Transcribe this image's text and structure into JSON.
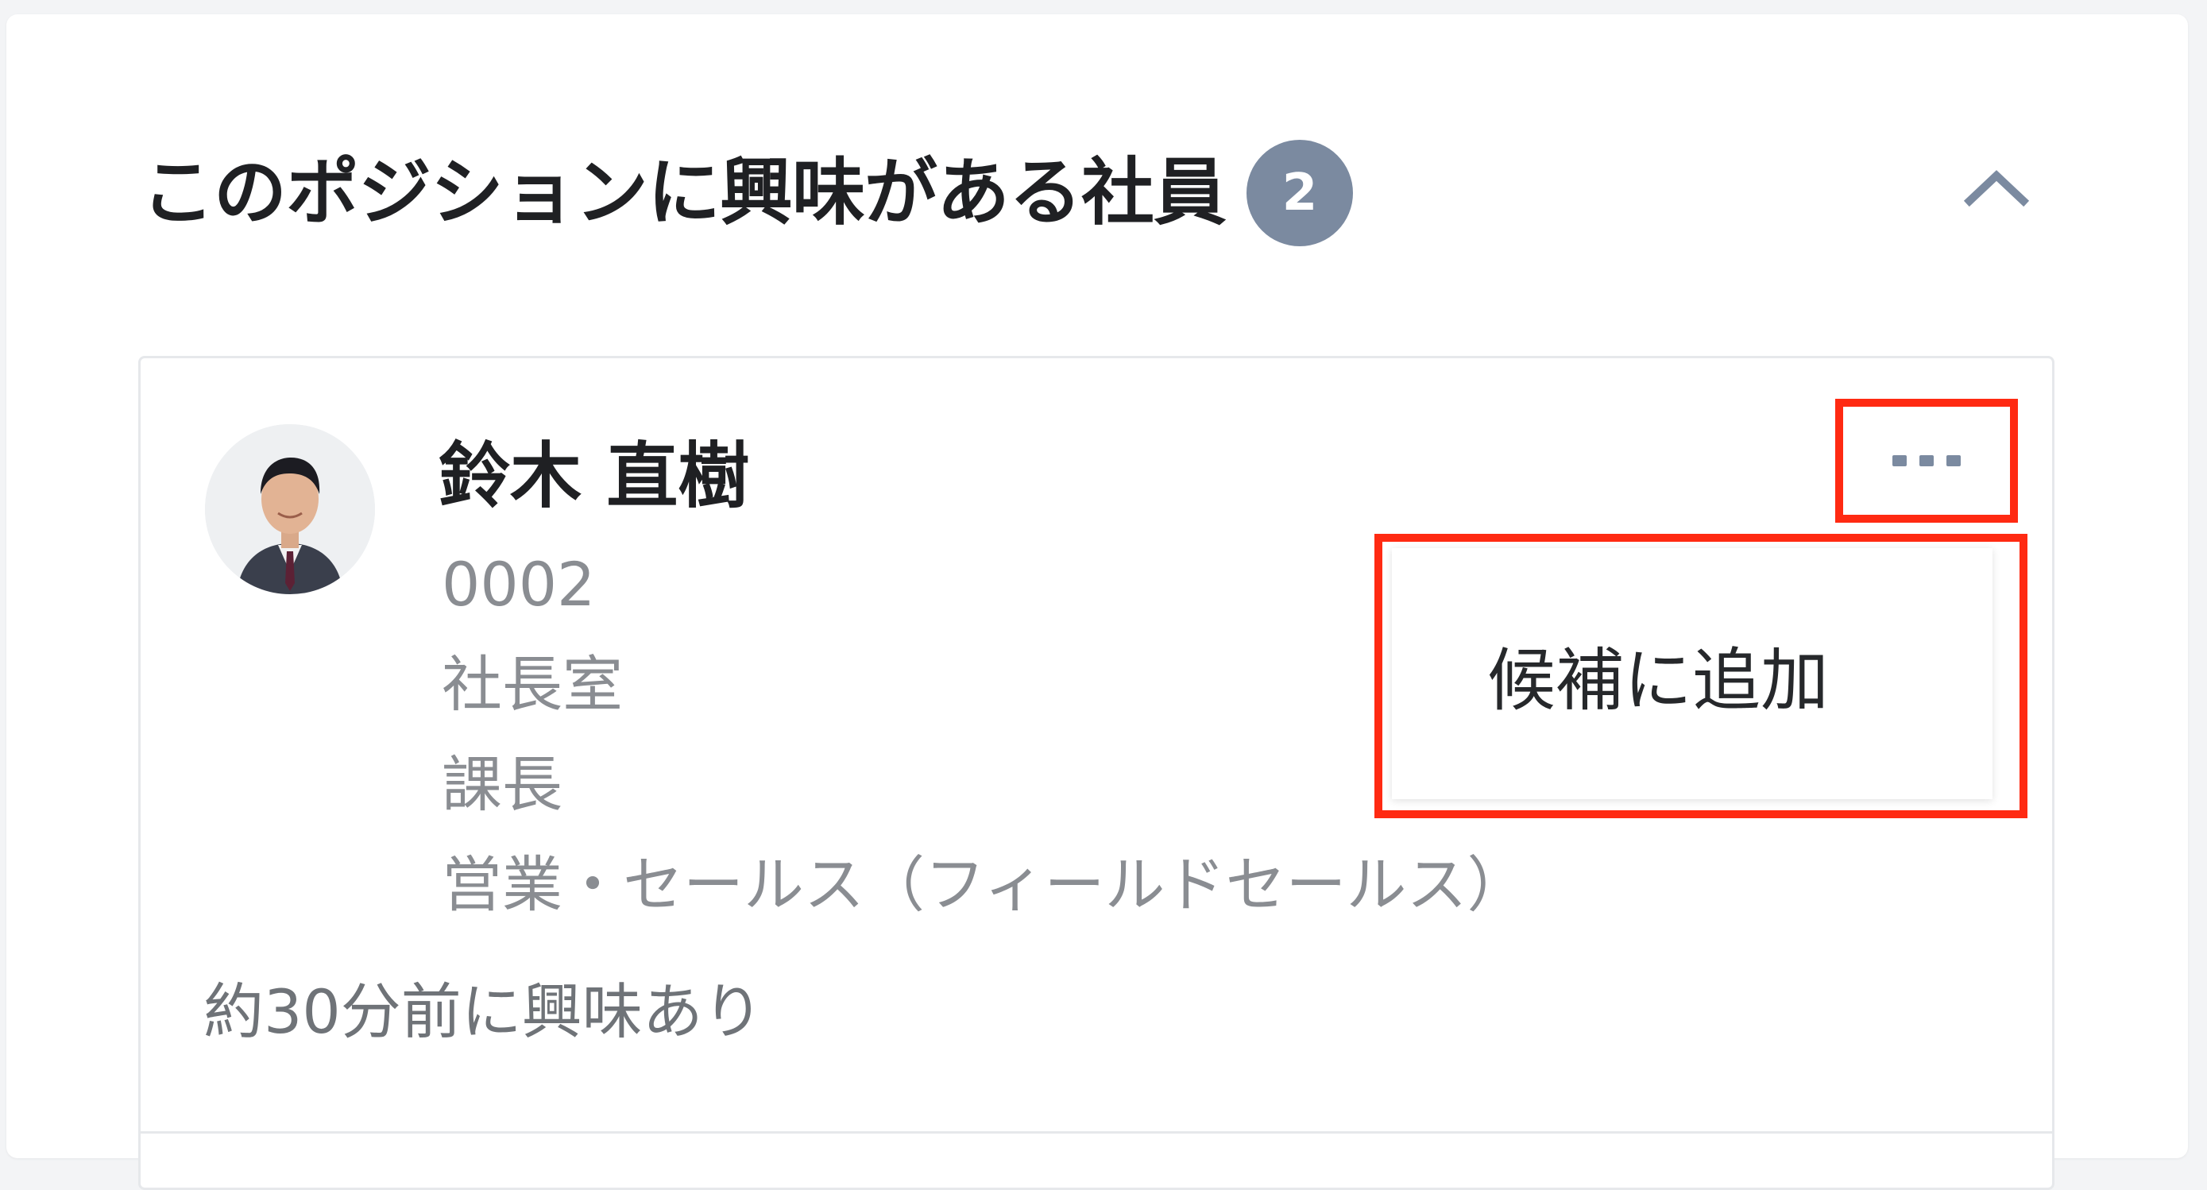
{
  "section": {
    "title": "このポジションに興味がある社員",
    "count": "2",
    "collapse_icon": "chevron-up-icon"
  },
  "employee": {
    "name": "鈴木 直樹",
    "employee_id": "0002",
    "department": "社長室",
    "position": "課長",
    "job_category": "営業・セールス（フィールドセールス）",
    "interest_time": "約30分前に興味あり",
    "avatar_icon": "person-avatar"
  },
  "actions": {
    "more_icon": "ellipsis-icon",
    "menu_items": [
      {
        "label": "候補に追加"
      }
    ]
  },
  "colors": {
    "highlight": "#ff2a12",
    "badge": "#7b8aa0",
    "title": "#1f2023",
    "muted_text": "#8a8d92"
  }
}
